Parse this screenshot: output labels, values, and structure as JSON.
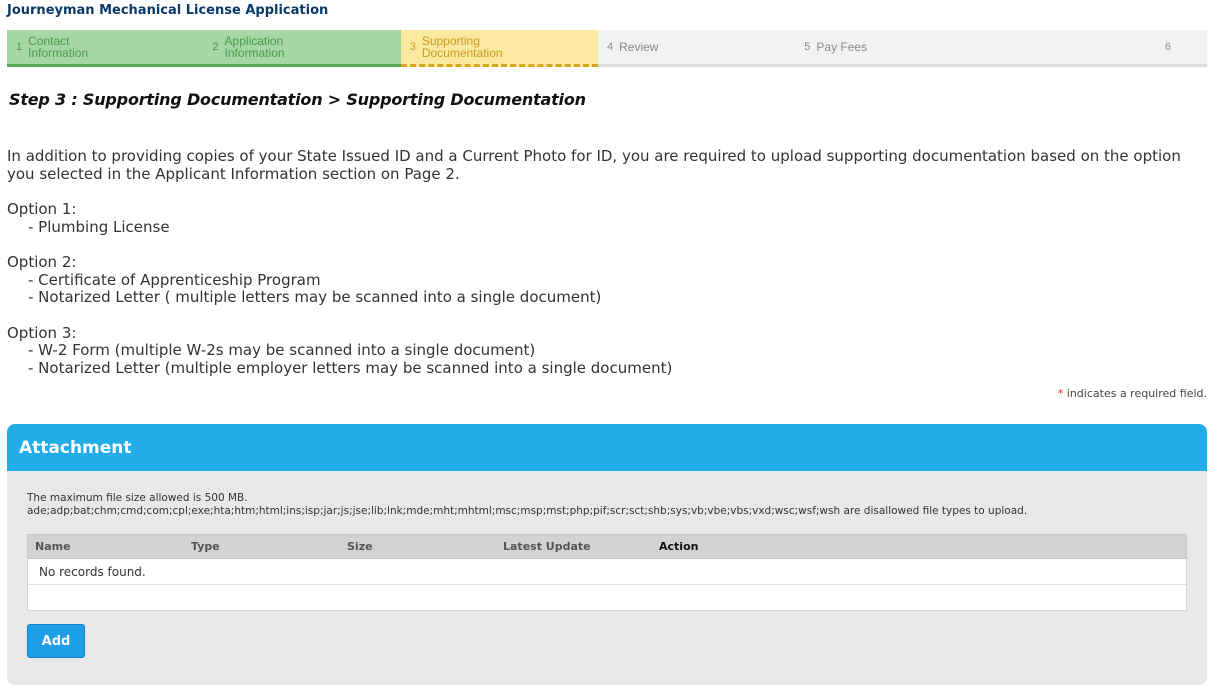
{
  "app": {
    "title": "Journeyman Mechanical License Application"
  },
  "steps": [
    {
      "num": "1",
      "label": "Contact Information",
      "state": "done"
    },
    {
      "num": "2",
      "label": "Application Information",
      "state": "done"
    },
    {
      "num": "3",
      "label": "Supporting Documentation",
      "state": "active"
    },
    {
      "num": "4",
      "label": "Review",
      "state": "todo"
    },
    {
      "num": "5",
      "label": "Pay Fees",
      "state": "todo"
    },
    {
      "num": "6",
      "label": "",
      "state": "todo"
    }
  ],
  "page": {
    "step_title": "Step 3 : Supporting Documentation > Supporting Documentation"
  },
  "instructions": {
    "intro": "In addition to providing copies of your State Issued ID and a Current Photo for ID, you are required to upload supporting documentation based on the option you selected in the Applicant Information section on Page 2.",
    "option1_title": "Option 1:",
    "option1_items": [
      "- Plumbing License"
    ],
    "option2_title": "Option 2:",
    "option2_items": [
      "- Certificate of Apprenticeship Program",
      "- Notarized Letter ( multiple letters may be scanned into a single document)"
    ],
    "option3_title": "Option 3:",
    "option3_items": [
      "- W-2 Form (multiple W-2s may be scanned into a single document)",
      "- Notarized Letter (multiple employer letters may be scanned into a single document)"
    ]
  },
  "required_note": {
    "star": "*",
    "text": " indicates a required field."
  },
  "attachment": {
    "title": "Attachment",
    "max_size": "The maximum file size allowed is 500 MB.",
    "disallowed": "ade;adp;bat;chm;cmd;com;cpl;exe;hta;htm;html;ins;isp;jar;js;jse;lib;lnk;mde;mht;mhtml;msc;msp;mst;php;pif;scr;sct;shb;sys;vb;vbe;vbs;vxd;wsc;wsf;wsh are disallowed file types to upload.",
    "columns": [
      "Name",
      "Type",
      "Size",
      "Latest Update",
      "Action"
    ],
    "empty_text": "No records found.",
    "add_label": "Add"
  },
  "colors": {
    "done": "#a5d6a5",
    "active": "#fbe9a0",
    "header": "#22ace8",
    "button": "#1e9ee8"
  }
}
